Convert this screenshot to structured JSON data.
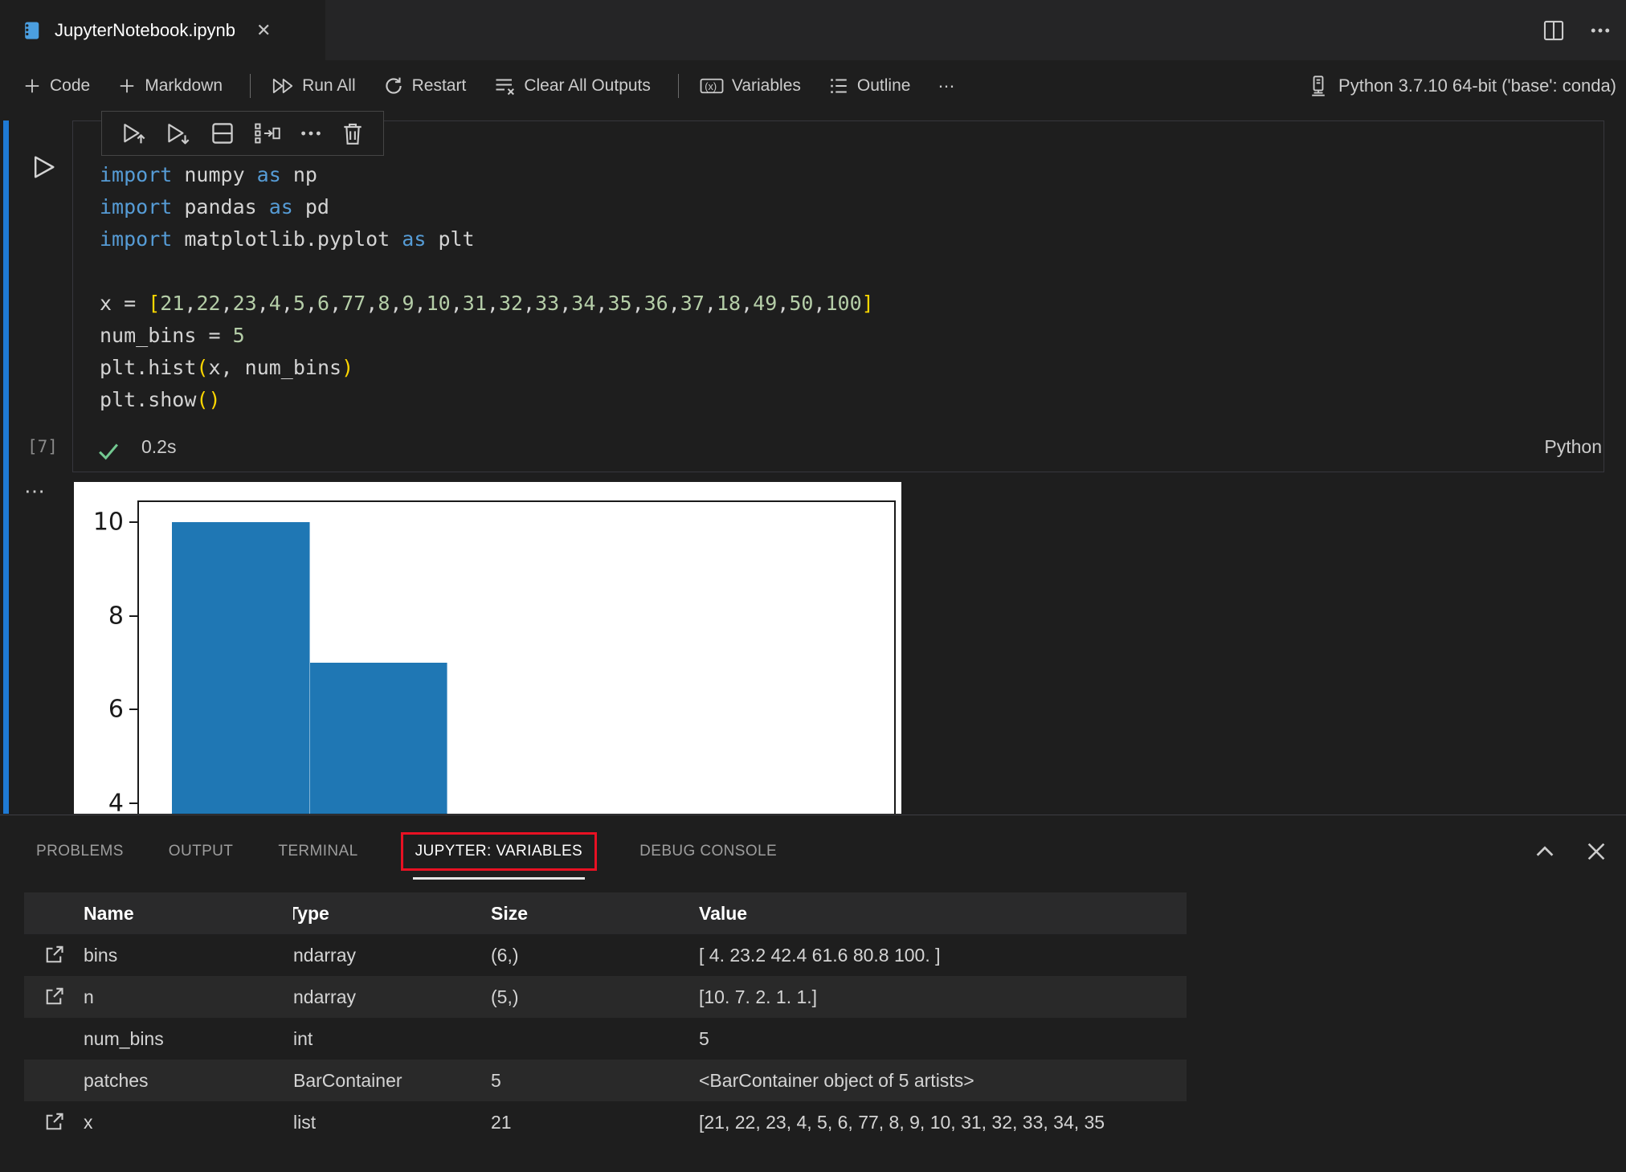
{
  "window": {
    "tab_title": "JupyterNotebook.ipynb",
    "close_label": "✕"
  },
  "toolbar": {
    "code": "Code",
    "markdown": "Markdown",
    "run_all": "Run All",
    "restart": "Restart",
    "clear_all_outputs": "Clear All Outputs",
    "variables": "Variables",
    "outline": "Outline",
    "more": "⋯",
    "kernel_label": "Python 3.7.10 64-bit ('base': conda)"
  },
  "cell": {
    "execution_count": "[7]",
    "duration": "0.2s",
    "language_indicator": "Python",
    "output_more": "⋯",
    "code_lines": [
      [
        [
          "import ",
          "k"
        ],
        [
          "numpy ",
          "p"
        ],
        [
          "as ",
          "k"
        ],
        [
          "np",
          "p"
        ]
      ],
      [
        [
          "import ",
          "k"
        ],
        [
          "pandas ",
          "p"
        ],
        [
          "as ",
          "k"
        ],
        [
          "pd",
          "p"
        ]
      ],
      [
        [
          "import ",
          "k"
        ],
        [
          "matplotlib.pyplot ",
          "p"
        ],
        [
          "as ",
          "k"
        ],
        [
          "plt",
          "p"
        ]
      ],
      [],
      [
        [
          "x = ",
          "p"
        ],
        [
          "[",
          "b"
        ],
        [
          "21",
          "n"
        ],
        [
          ",",
          "p"
        ],
        [
          "22",
          "n"
        ],
        [
          ",",
          "p"
        ],
        [
          "23",
          "n"
        ],
        [
          ",",
          "p"
        ],
        [
          "4",
          "n"
        ],
        [
          ",",
          "p"
        ],
        [
          "5",
          "n"
        ],
        [
          ",",
          "p"
        ],
        [
          "6",
          "n"
        ],
        [
          ",",
          "p"
        ],
        [
          "77",
          "n"
        ],
        [
          ",",
          "p"
        ],
        [
          "8",
          "n"
        ],
        [
          ",",
          "p"
        ],
        [
          "9",
          "n"
        ],
        [
          ",",
          "p"
        ],
        [
          "10",
          "n"
        ],
        [
          ",",
          "p"
        ],
        [
          "31",
          "n"
        ],
        [
          ",",
          "p"
        ],
        [
          "32",
          "n"
        ],
        [
          ",",
          "p"
        ],
        [
          "33",
          "n"
        ],
        [
          ",",
          "p"
        ],
        [
          "34",
          "n"
        ],
        [
          ",",
          "p"
        ],
        [
          "35",
          "n"
        ],
        [
          ",",
          "p"
        ],
        [
          "36",
          "n"
        ],
        [
          ",",
          "p"
        ],
        [
          "37",
          "n"
        ],
        [
          ",",
          "p"
        ],
        [
          "18",
          "n"
        ],
        [
          ",",
          "p"
        ],
        [
          "49",
          "n"
        ],
        [
          ",",
          "p"
        ],
        [
          "50",
          "n"
        ],
        [
          ",",
          "p"
        ],
        [
          "100",
          "n"
        ],
        [
          "]",
          "b"
        ]
      ],
      [
        [
          "num_bins ",
          "p"
        ],
        [
          "= ",
          "p"
        ],
        [
          "5",
          "n"
        ]
      ],
      [
        [
          "plt.hist",
          "p"
        ],
        [
          "(",
          "b"
        ],
        [
          "x",
          "p"
        ],
        [
          ", ",
          "p"
        ],
        [
          "num_bins",
          "p"
        ],
        [
          ")",
          "b"
        ]
      ],
      [
        [
          "plt.show",
          "p"
        ],
        [
          "(",
          "b"
        ],
        [
          ")",
          "b"
        ]
      ]
    ]
  },
  "chart_data": {
    "type": "bar",
    "subtype": "histogram",
    "bins": [
      4,
      23.2,
      42.4,
      61.6,
      80.8,
      100
    ],
    "counts": [
      10,
      7,
      2,
      1,
      1
    ],
    "yticks_visible": [
      4,
      6,
      8,
      10
    ],
    "title": "",
    "xlabel": "",
    "ylabel": "",
    "bar_color": "#1f77b4",
    "background": "#ffffff",
    "note": "matplotlib histogram output, bottom of figure cropped by bottom panel; only bars 10 and 7 visible"
  },
  "panel": {
    "tabs": [
      "PROBLEMS",
      "OUTPUT",
      "TERMINAL",
      "JUPYTER: VARIABLES",
      "DEBUG CONSOLE"
    ],
    "active_tab": "JUPYTER: VARIABLES",
    "annotation_color": "#e81123",
    "table": {
      "columns": [
        "Name",
        "Type",
        "Size",
        "Value"
      ],
      "sorted_column": "Type",
      "rows": [
        {
          "name": "bins",
          "type": "ndarray",
          "size": "(6,)",
          "value": "[ 4.  23.2 42.4 61.6 80.8 100. ]",
          "viewer": true
        },
        {
          "name": "n",
          "type": "ndarray",
          "size": "(5,)",
          "value": "[10.  7.  2.  1.  1.]",
          "viewer": true
        },
        {
          "name": "num_bins",
          "type": "int",
          "size": "",
          "value": "5",
          "viewer": false
        },
        {
          "name": "patches",
          "type": "BarContainer",
          "size": "5",
          "value": "<BarContainer object of 5 artists>",
          "viewer": false
        },
        {
          "name": "x",
          "type": "list",
          "size": "21",
          "value": "[21, 22, 23, 4, 5, 6, 77, 8, 9, 10, 31, 32, 33, 34, 35",
          "viewer": true
        }
      ]
    }
  },
  "colors": {
    "accent_focus_bar": "#1f7ad4",
    "keyword": "#569cd6",
    "number": "#b5cea8",
    "bracket": "#ffd700",
    "check": "#73c991",
    "bar": "#1f77b4",
    "annotation_red": "#e81123"
  }
}
